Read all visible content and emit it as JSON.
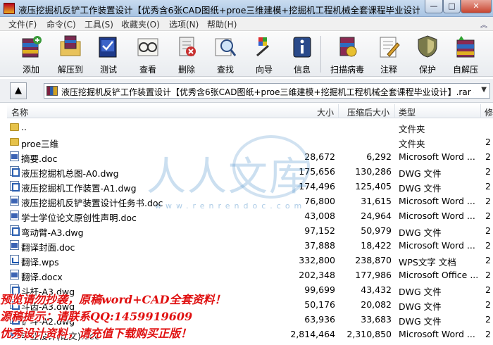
{
  "window": {
    "title": "液压挖掘机反铲工作装置设计【优秀含6张CAD图纸+proe三维建模+挖掘机工程机械全套课程毕业设计...",
    "min": "—",
    "max": "□",
    "close": "✕"
  },
  "menu": [
    "文件(F)",
    "命令(C)",
    "工具(S)",
    "收藏夹(O)",
    "选项(N)",
    "帮助(H)"
  ],
  "toolbar": [
    {
      "label": "添加",
      "icon": "add-archive-icon"
    },
    {
      "label": "解压到",
      "icon": "extract-to-icon"
    },
    {
      "label": "测试",
      "icon": "test-icon"
    },
    {
      "label": "查看",
      "icon": "view-icon"
    },
    {
      "label": "删除",
      "icon": "delete-icon"
    },
    {
      "label": "查找",
      "icon": "find-icon"
    },
    {
      "label": "向导",
      "icon": "wizard-icon"
    },
    {
      "label": "信息",
      "icon": "info-icon"
    },
    {
      "label": "扫描病毒",
      "icon": "virus-scan-icon"
    },
    {
      "label": "注释",
      "icon": "comment-icon"
    },
    {
      "label": "保护",
      "icon": "protect-icon"
    },
    {
      "label": "自解压",
      "icon": "sfx-icon"
    }
  ],
  "address": {
    "path": "液压挖掘机反铲工作装置设计【优秀含6张CAD图纸+proe三维建模+挖掘机工程机械全套课程毕业设计】.rar - "
  },
  "columns": {
    "name": "名称",
    "size": "大小",
    "packed": "压缩后大小",
    "type": "类型",
    "extra": "修"
  },
  "files": [
    {
      "name": "..",
      "size": "",
      "packed": "",
      "type": "文件夹",
      "extra": "",
      "icon": "folder"
    },
    {
      "name": "proe三维",
      "size": "",
      "packed": "",
      "type": "文件夹",
      "extra": "2",
      "icon": "folder"
    },
    {
      "name": "摘要.doc",
      "size": "28,672",
      "packed": "6,292",
      "type": "Microsoft Word ...",
      "extra": "2",
      "icon": "doc"
    },
    {
      "name": "液压挖掘机总图-A0.dwg",
      "size": "175,656",
      "packed": "130,286",
      "type": "DWG 文件",
      "extra": "2",
      "icon": "dwg"
    },
    {
      "name": "液压挖掘机工作装置-A1.dwg",
      "size": "174,496",
      "packed": "125,405",
      "type": "DWG 文件",
      "extra": "2",
      "icon": "dwg"
    },
    {
      "name": "液压挖掘机反铲装置设计任务书.doc",
      "size": "76,800",
      "packed": "31,615",
      "type": "Microsoft Word ...",
      "extra": "2",
      "icon": "doc"
    },
    {
      "name": "学士学位论文原创性声明.doc",
      "size": "43,008",
      "packed": "24,964",
      "type": "Microsoft Word ...",
      "extra": "2",
      "icon": "doc"
    },
    {
      "name": "弯动臂-A3.dwg",
      "size": "97,152",
      "packed": "50,979",
      "type": "DWG 文件",
      "extra": "2",
      "icon": "dwg"
    },
    {
      "name": "翻译封面.doc",
      "size": "37,888",
      "packed": "18,422",
      "type": "Microsoft Word ...",
      "extra": "2",
      "icon": "doc"
    },
    {
      "name": "翻译.wps",
      "size": "332,800",
      "packed": "238,870",
      "type": "WPS文字 文档",
      "extra": "2",
      "icon": "wps"
    },
    {
      "name": "翻译.docx",
      "size": "202,348",
      "packed": "177,986",
      "type": "Microsoft Office ...",
      "extra": "2",
      "icon": "doc"
    },
    {
      "name": "斗杆-A3.dwg",
      "size": "99,699",
      "packed": "43,432",
      "type": "DWG 文件",
      "extra": "2",
      "icon": "dwg"
    },
    {
      "name": "斗齿-A3.dwg",
      "size": "50,176",
      "packed": "20,082",
      "type": "DWG 文件",
      "extra": "2",
      "icon": "dwg"
    },
    {
      "name": "铲斗-A2.dwg",
      "size": "63,936",
      "packed": "33,683",
      "type": "DWG 文件",
      "extra": "2",
      "icon": "dwg"
    },
    {
      "name": "毕业设计(论文).doc",
      "size": "2,814,464",
      "packed": "2,310,850",
      "type": "Microsoft Word ...",
      "extra": "2",
      "icon": "doc"
    }
  ],
  "watermark": {
    "text": "人人文库",
    "url": "www.renrendoc.com"
  },
  "overlay": [
    "预览请勿抄袭，原稿word+CAD全套资料！",
    "源稿提示：请联系QQ:1459919609",
    "优秀设计资料，请充值下载购买正版！"
  ]
}
